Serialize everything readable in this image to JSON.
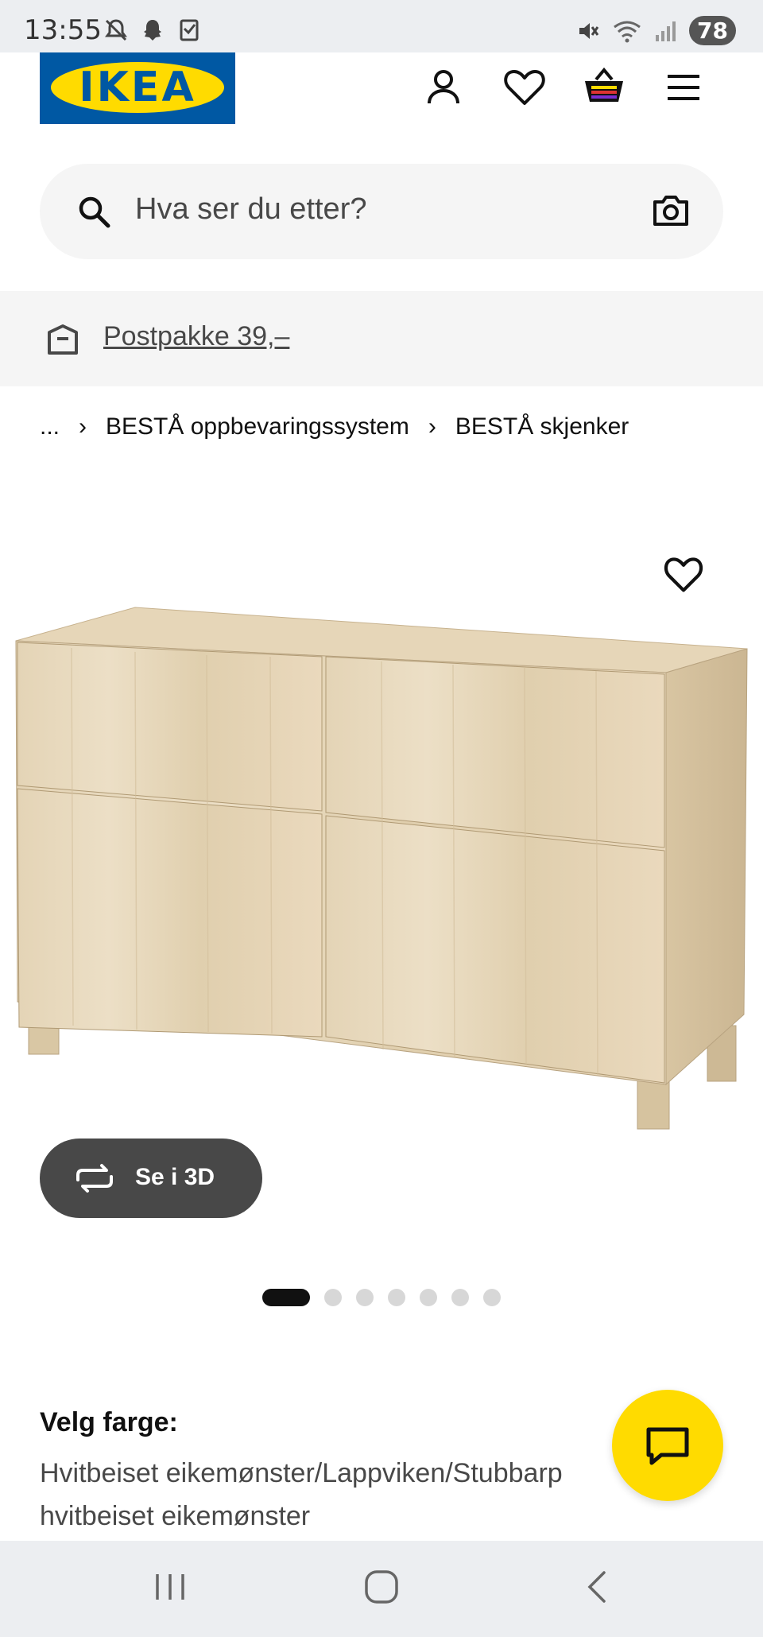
{
  "status_bar": {
    "time": "13:55",
    "battery": "78",
    "network": "6E"
  },
  "header": {
    "logo_text": "IKEA",
    "icons": [
      "profile-icon",
      "heart-icon",
      "basket-icon",
      "hamburger-menu-icon"
    ]
  },
  "search": {
    "placeholder": "Hva ser du etter?"
  },
  "banner": {
    "text": "Postpakke 39,–"
  },
  "breadcrumb": {
    "items": [
      "...",
      "BESTÅ oppbevaringssystem",
      "BESTÅ skjenker"
    ]
  },
  "product": {
    "view_3d_label": "Se i 3D",
    "image_count": 7,
    "active_image": 1
  },
  "color_selector": {
    "title": "Velg farge:",
    "value": "Hvitbeiset eikemønster/Lappviken/Stubbarp hvitbeiset eikemønster"
  },
  "colors": {
    "ikea_blue": "#0058a3",
    "ikea_yellow": "#ffdb00",
    "dark_button": "#484848"
  }
}
